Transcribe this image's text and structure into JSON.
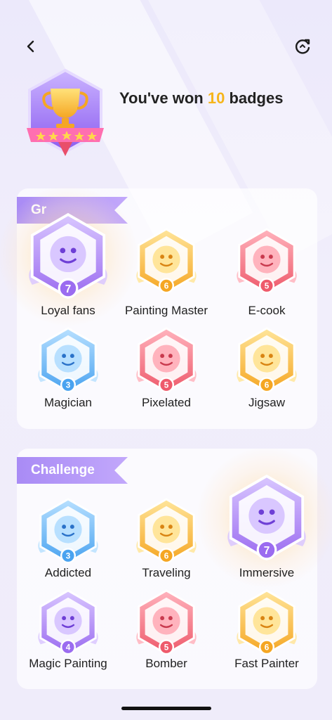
{
  "header": {
    "headline_prefix": "You've won ",
    "badge_count": "10",
    "headline_suffix": " badges"
  },
  "sections": [
    {
      "title": "Gr",
      "badges": [
        {
          "label": "Loyal fans",
          "level": "7",
          "color": "purple"
        },
        {
          "label": "Painting Master",
          "level": "6",
          "color": "gold"
        },
        {
          "label": "E-cook",
          "level": "5",
          "color": "red"
        },
        {
          "label": "Magician",
          "level": "3",
          "color": "blue"
        },
        {
          "label": "Pixelated",
          "level": "5",
          "color": "red"
        },
        {
          "label": "Jigsaw",
          "level": "6",
          "color": "gold"
        }
      ]
    },
    {
      "title": "Challenge",
      "badges": [
        {
          "label": "Addicted",
          "level": "3",
          "color": "blue"
        },
        {
          "label": "Traveling",
          "level": "6",
          "color": "gold"
        },
        {
          "label": "Immersive",
          "level": "7",
          "color": "purple"
        },
        {
          "label": "Magic Painting",
          "level": "4",
          "color": "purple"
        },
        {
          "label": "Bomber",
          "level": "5",
          "color": "red"
        },
        {
          "label": "Fast Painter",
          "level": "6",
          "color": "gold"
        }
      ]
    }
  ],
  "colors": {
    "accent_count": "#f6b51b",
    "ribbon": "#b398f7",
    "purple": "#9b6cf0",
    "gold": "#f5a623",
    "red": "#ee5a6b",
    "blue": "#4aa3f0"
  }
}
